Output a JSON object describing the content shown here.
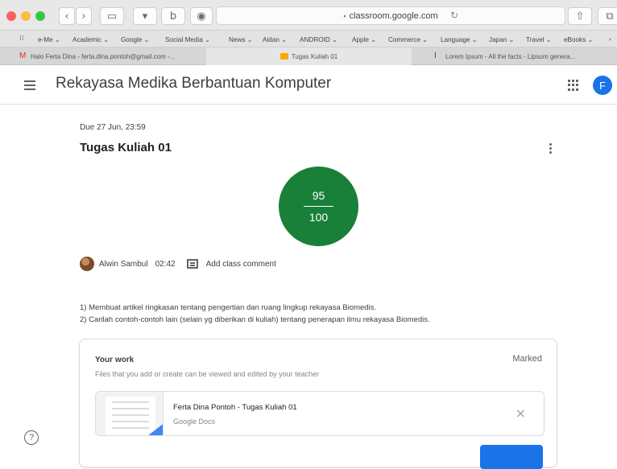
{
  "browser": {
    "url": "classroom.google.com",
    "nav_back": "‹",
    "nav_forward": "›",
    "sidebar_glyph": "▭",
    "pocket_glyph": "▾",
    "bookmark_b_glyph": "b",
    "addon_glyph": "◉",
    "share_glyph": "⇧",
    "tabs_glyph": "⧉",
    "reload_glyph": "↻",
    "bookmarks": [
      "e-Me ⌄",
      "Academic ⌄",
      "Google ⌄",
      "Social Media ⌄",
      "News ⌄",
      "Aidan ⌄",
      "ANDROID ⌄",
      "Apple ⌄",
      "Commerce ⌄",
      "Language ⌄",
      "Japan ⌄",
      "Travel ⌄",
      "eBooks ⌄",
      "›"
    ],
    "tabs": [
      {
        "label": "Halo Ferta Dina - ferta.dina.pontoh@gmail.com -..."
      },
      {
        "label": "Tugas Kuliah 01"
      },
      {
        "label": "Lorem Ipsum - All the facts - Lipsum genera..."
      }
    ]
  },
  "app": {
    "title": "Rekayasa Medika Berbantuan Komputer",
    "avatar_letter": "F"
  },
  "assignment": {
    "due": "Due 27 Jun, 23:59",
    "title": "Tugas Kuliah 01",
    "grade": {
      "score": "95",
      "max": "100"
    },
    "comment": {
      "author": "Alwin Sambul",
      "time": "02:42",
      "action": "Add class comment"
    },
    "instructions": [
      "1) Membuat artikel ringkasan tentang pengertian dan ruang lingkup rekayasa Biomedis.",
      "2) Carilah contoh-contoh lain (selain yg diberikan di kuliah) tentang penerapan ilmu rekayasa Biomedis."
    ]
  },
  "your_work": {
    "title": "Your work",
    "status": "Marked",
    "subtitle": "Files that you add or create can be viewed and edited by your teacher",
    "attachment": {
      "name": "Ferta Dina Pontoh - Tugas Kuliah 01",
      "type": "Google Docs",
      "remove": "×"
    }
  },
  "help_glyph": "?",
  "colors": {
    "accent": "#1a73e8",
    "grade_bg": "#188038"
  }
}
